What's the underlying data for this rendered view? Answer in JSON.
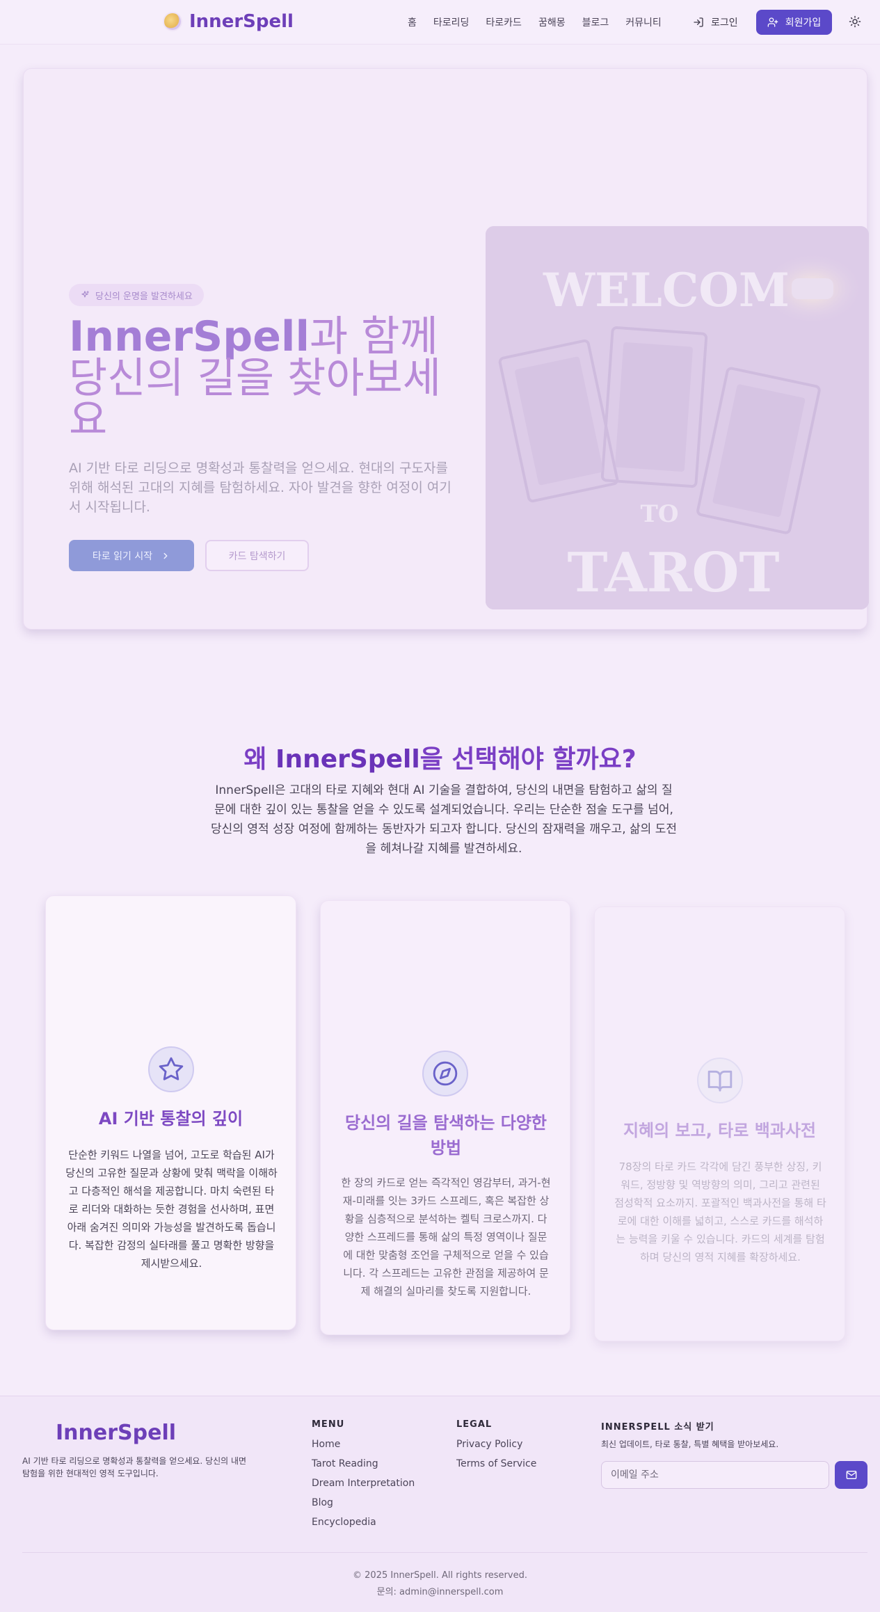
{
  "header": {
    "logo": "InnerSpell",
    "nav": [
      "홈",
      "타로리딩",
      "타로카드",
      "꿈해몽",
      "블로그",
      "커뮤니티"
    ],
    "login_label": "로그인",
    "signup_label": "회원가입"
  },
  "hero": {
    "badge": "당신의 운명을 발견하세요",
    "title_brand": "InnerSpell",
    "title_rest": "과 함께 당신의 길을 찾아보세요",
    "description": "AI 기반 타로 리딩으로 명확성과 통찰력을 얻으세요. 현대의 구도자를 위해 해석된 고대의 지혜를 탐험하세요. 자아 발견을 향한 여정이 여기서 시작됩니다.",
    "primary_button": "타로 읽기 시작",
    "secondary_button": "카드 탐색하기",
    "image_text_top": "WELCOM",
    "image_text_mid": "TO",
    "image_text_bottom": "TAROT"
  },
  "why": {
    "title_pre": "왜 ",
    "title_brand": "InnerSpell",
    "title_post": "을 선택해야 할까요?",
    "description": "InnerSpell은 고대의 타로 지혜와 현대 AI 기술을 결합하여, 당신의 내면을 탐험하고 삶의 질문에 대한 깊이 있는 통찰을 얻을 수 있도록 설계되었습니다. 우리는 단순한 점술 도구를 넘어, 당신의 영적 성장 여정에 함께하는 동반자가 되고자 합니다. 당신의 잠재력을 깨우고, 삶의 도전을 헤쳐나갈 지혜를 발견하세요.",
    "cards": [
      {
        "icon": "star-icon",
        "title": "AI 기반 통찰의 깊이",
        "description": "단순한 키워드 나열을 넘어, 고도로 학습된 AI가 당신의 고유한 질문과 상황에 맞춰 맥락을 이해하고 다층적인 해석을 제공합니다. 마치 숙련된 타로 리더와 대화하는 듯한 경험을 선사하며, 표면 아래 숨겨진 의미와 가능성을 발견하도록 돕습니다. 복잡한 감정의 실타래를 풀고 명확한 방향을 제시받으세요."
      },
      {
        "icon": "compass-icon",
        "title": "당신의 길을 탐색하는 다양한 방법",
        "description": "한 장의 카드로 얻는 즉각적인 영감부터, 과거-현재-미래를 잇는 3카드 스프레드, 혹은 복잡한 상황을 심층적으로 분석하는 켈틱 크로스까지. 다양한 스프레드를 통해 삶의 특정 영역이나 질문에 대한 맞춤형 조언을 구체적으로 얻을 수 있습니다. 각 스프레드는 고유한 관점을 제공하여 문제 해결의 실마리를 찾도록 지원합니다."
      },
      {
        "icon": "book-open-icon",
        "title": "지혜의 보고, 타로 백과사전",
        "description": "78장의 타로 카드 각각에 담긴 풍부한 상징, 키워드, 정방향 및 역방향의 의미, 그리고 관련된 점성학적 요소까지. 포괄적인 백과사전을 통해 타로에 대한 이해를 넓히고, 스스로 카드를 해석하는 능력을 키울 수 있습니다. 카드의 세계를 탐험하며 당신의 영적 지혜를 확장하세요."
      }
    ]
  },
  "footer": {
    "logo": "InnerSpell",
    "tagline": "AI 기반 타로 리딩으로 명확성과 통찰력을 얻으세요. 당신의 내면 탐험을 위한 현대적인 영적 도구입니다.",
    "menu_title": "MENU",
    "menu_links": [
      "Home",
      "Tarot Reading",
      "Dream Interpretation",
      "Blog",
      "Encyclopedia"
    ],
    "legal_title": "LEGAL",
    "legal_links": [
      "Privacy Policy",
      "Terms of Service"
    ],
    "newsletter_title": "INNERSPELL 소식 받기",
    "newsletter_desc": "최신 업데이트, 타로 통찰, 특별 혜택을 받아보세요.",
    "email_placeholder": "이메일 주소",
    "copyright": "© 2025 InnerSpell. All rights reserved.",
    "contact": "문의: admin@innerspell.com"
  }
}
